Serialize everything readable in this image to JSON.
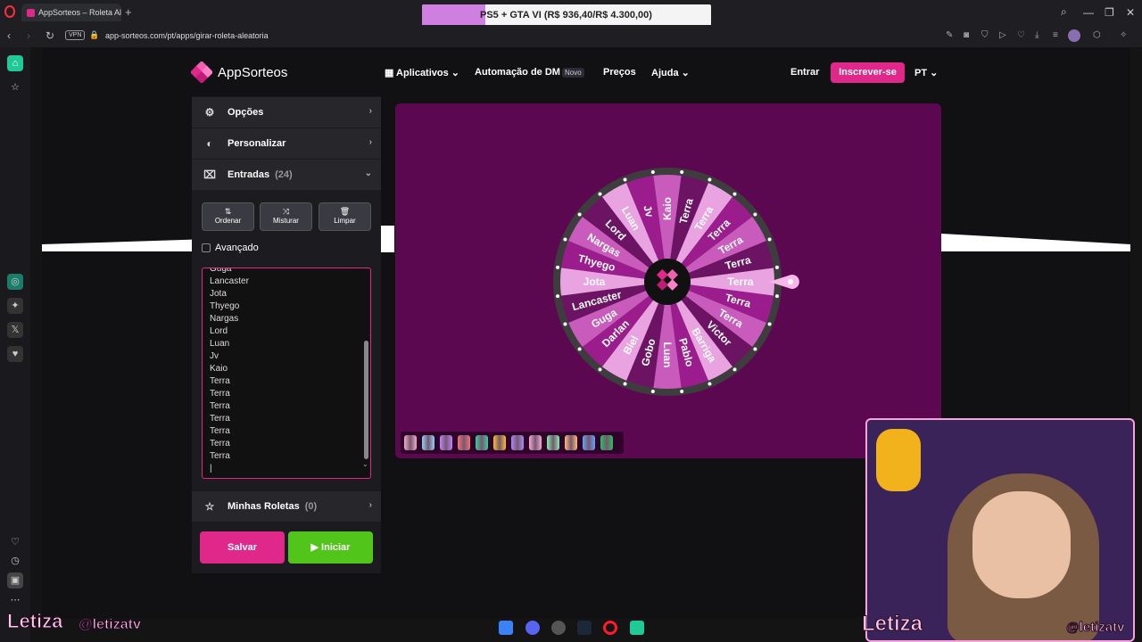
{
  "browser": {
    "tab_title": "AppSorteos – Roleta Aleat",
    "new_tab": "+",
    "url": "app-sorteos.com/pt/apps/girar-roleta-aleatoria",
    "vpn_label": "VPN",
    "promo_text": "PS5 + GTA VI (R$ 936,40/R$ 4.300,00)",
    "promo_progress": 0.218,
    "window_min": "—",
    "window_max": "❐",
    "window_close": "✕",
    "back": "‹",
    "forward": "›",
    "reload": "↻"
  },
  "header": {
    "brand": "AppSorteos",
    "nav": [
      {
        "label": "Aplicativos",
        "icon": "grid-icon",
        "has_dropdown": true
      },
      {
        "label": "Automação de DM",
        "badge": "Novo"
      },
      {
        "label": "Preços"
      },
      {
        "label": "Ajuda",
        "has_dropdown": true
      }
    ],
    "login": "Entrar",
    "signup": "Inscrever-se",
    "language": "PT"
  },
  "panel": {
    "options": "Opções",
    "customize": "Personalizar",
    "entries_label": "Entradas",
    "entries_count": "(24)",
    "tools": [
      {
        "label": "Ordenar",
        "icon": "⇅"
      },
      {
        "label": "Misturar",
        "icon": "⤨"
      },
      {
        "label": "Limpar",
        "icon": "🗑"
      }
    ],
    "advanced": "Avançado",
    "entries_list": [
      "Guga",
      "Lancaster",
      "Jota",
      "Thyego",
      "Nargas",
      "Lord",
      "Luan",
      "Jv",
      "Kaio",
      "Terra",
      "Terra",
      "Terra",
      "Terra",
      "Terra",
      "Terra",
      "Terra"
    ],
    "my_wheels": "Minhas Roletas",
    "my_wheels_count": "(0)",
    "save": "Salvar",
    "start": "▶ Iniciar"
  },
  "wheel": {
    "labels": [
      "Terra",
      "Terra",
      "Terra",
      "Victor",
      "Barriga",
      "Pablo",
      "Luan",
      "Gobo",
      "Biel",
      "Darlan",
      "Guga",
      "Lancaster",
      "Jota",
      "Thyego",
      "Nargas",
      "Lord",
      "Luan",
      "Jv",
      "Kaio",
      "Terra",
      "Terra",
      "Terra",
      "Terra",
      "Terra"
    ],
    "colors": [
      "#e8a3e0",
      "#9b1c8c",
      "#c85bbb",
      "#6d1364",
      "#e8a3e0",
      "#9b1c8c",
      "#c85bbb",
      "#6d1364"
    ],
    "pointer_color": "#f7b7ea"
  },
  "palettes": [
    "#f3a9c8",
    "#8fd3f4",
    "#c084fc",
    "#f87171",
    "#34d399",
    "#fbbf24",
    "#a78bfa",
    "#f9a8d4",
    "#86efac",
    "#fdba74",
    "#60a5fa",
    "#22c55e"
  ],
  "stream": {
    "name_left": "Letiza",
    "handle_left": "@letizatv",
    "name_right": "Letiza",
    "handle_right": "@letizatv"
  }
}
